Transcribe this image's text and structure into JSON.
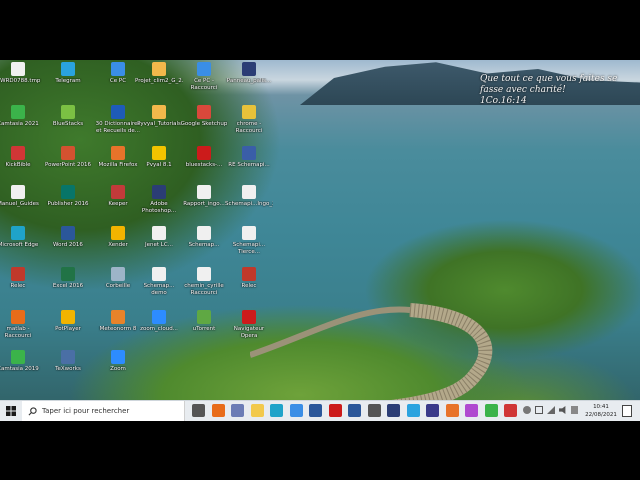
{
  "quote": {
    "line1": "Que tout ce que vous faites se",
    "line2": "fasse avec charité!",
    "line3": "1Co.16:14"
  },
  "icons": [
    {
      "label": "~WRD0788.tmp",
      "icon": "file-icon",
      "color": "#f0f0f0"
    },
    {
      "label": "Telegram",
      "icon": "telegram-icon",
      "color": "#2aa3df"
    },
    {
      "label": "Ce PC",
      "icon": "computer-icon",
      "color": "#3a8ee6"
    },
    {
      "label": "Projet_clim2_G_2...",
      "icon": "file-icon",
      "color": "#f2b84b"
    },
    {
      "label": "Ce PC - Raccourci",
      "icon": "computer-icon",
      "color": "#3a8ee6"
    },
    {
      "label": "Panneau_palis...",
      "icon": "photoshop-icon",
      "color": "#2b3d75"
    },
    {
      "label": "Camtasia 2021",
      "icon": "camtasia-icon",
      "color": "#3bb34a"
    },
    {
      "label": "BlueStacks",
      "icon": "bluestacks-icon",
      "color": "#7bc043"
    },
    {
      "label": "30 Dictionnaires et Recueils de...",
      "icon": "book-icon",
      "color": "#1e5bb8"
    },
    {
      "label": "Pyvyal_Tutorials",
      "icon": "file-icon",
      "color": "#f2b84b"
    },
    {
      "label": "Google Sketchup",
      "icon": "sketchup-icon",
      "color": "#d9483b"
    },
    {
      "label": "chrome - Raccourci",
      "icon": "chrome-icon",
      "color": "#e8c23a"
    },
    {
      "label": "KickBible",
      "icon": "bible-icon",
      "color": "#d03636"
    },
    {
      "label": "PowerPoint 2016",
      "icon": "powerpoint-icon",
      "color": "#d35230"
    },
    {
      "label": "Mozilla Firefox",
      "icon": "firefox-icon",
      "color": "#e8732a"
    },
    {
      "label": "Pvyal 8.1",
      "icon": "file-icon",
      "color": "#f2c400"
    },
    {
      "label": "bluestacks-...",
      "icon": "opera-icon",
      "color": "#cc1b1b"
    },
    {
      "label": "RE Schemapi...",
      "icon": "file-icon",
      "color": "#3a5ea8"
    },
    {
      "label": "Manuel_Guides",
      "icon": "file-icon",
      "color": "#f0f0f0"
    },
    {
      "label": "Publisher 2016",
      "icon": "publisher-icon",
      "color": "#077568"
    },
    {
      "label": "Keeper",
      "icon": "file-icon",
      "color": "#c23a3a"
    },
    {
      "label": "Adobe Photoshop...",
      "icon": "photoshop-icon",
      "color": "#2b3d75"
    },
    {
      "label": "Rapport_ingo...",
      "icon": "file-icon",
      "color": "#f0f0f0"
    },
    {
      "label": "Schemapi...Ingo_2(1)",
      "icon": "file-icon",
      "color": "#f0f0f0"
    },
    {
      "label": "Microsoft Edge",
      "icon": "edge-icon",
      "color": "#1fa3c9"
    },
    {
      "label": "Word 2016",
      "icon": "word-icon",
      "color": "#2b579a"
    },
    {
      "label": "Xender",
      "icon": "xender-icon",
      "color": "#f2b400"
    },
    {
      "label": "Jenet LC...",
      "icon": "file-icon",
      "color": "#f0f0f0"
    },
    {
      "label": "Schemap...",
      "icon": "file-icon",
      "color": "#f0f0f0"
    },
    {
      "label": "Schemapi... Tierce...",
      "icon": "file-icon",
      "color": "#f0f0f0"
    },
    {
      "label": "Relec",
      "icon": "relec-icon",
      "color": "#c0392b"
    },
    {
      "label": "Excel 2016",
      "icon": "excel-icon",
      "color": "#217346"
    },
    {
      "label": "Corbeille",
      "icon": "recycle-bin-icon",
      "color": "#9db4c8"
    },
    {
      "label": "Schemap... demo",
      "icon": "file-icon",
      "color": "#f0f0f0"
    },
    {
      "label": "chemin_cyrille Raccourci",
      "icon": "file-icon",
      "color": "#f0f0f0"
    },
    {
      "label": "Relec",
      "icon": "relec-icon",
      "color": "#c0392b"
    },
    {
      "label": "matlab - Raccourci",
      "icon": "matlab-icon",
      "color": "#e86c1a"
    },
    {
      "label": "PotPlayer",
      "icon": "potplayer-icon",
      "color": "#f2b400"
    },
    {
      "label": "Meteonorm 8",
      "icon": "meteonorm-icon",
      "color": "#e8832a"
    },
    {
      "label": "zoom_cloud...",
      "icon": "zoom-icon",
      "color": "#2d8cff"
    },
    {
      "label": "uTorrent",
      "icon": "utorrent-icon",
      "color": "#5fa843"
    },
    {
      "label": "Navigateur Opera",
      "icon": "opera-icon",
      "color": "#cc1b1b"
    },
    {
      "label": "Camtasia 2019",
      "icon": "camtasia-icon",
      "color": "#3bb34a"
    },
    {
      "label": "TeXworks",
      "icon": "texworks-icon",
      "color": "#4a6fa5"
    },
    {
      "label": "Zoom",
      "icon": "zoom-icon",
      "color": "#2d8cff"
    }
  ],
  "taskbar": {
    "search_placeholder": "Taper ici pour rechercher",
    "time": "10:41",
    "date": "22/08/2021",
    "apps": [
      {
        "icon": "task-view-icon",
        "color": "#555555"
      },
      {
        "icon": "matlab-icon",
        "color": "#e86c1a"
      },
      {
        "icon": "app-icon",
        "color": "#6b7cb5"
      },
      {
        "icon": "explorer-icon",
        "color": "#f2c94c"
      },
      {
        "icon": "edge-icon",
        "color": "#1fa3c9"
      },
      {
        "icon": "store-icon",
        "color": "#3a8ee6"
      },
      {
        "icon": "mail-icon",
        "color": "#2b579a"
      },
      {
        "icon": "opera-icon",
        "color": "#cc1b1b"
      },
      {
        "icon": "word-icon",
        "color": "#2b579a"
      },
      {
        "icon": "monitor-icon",
        "color": "#555555"
      },
      {
        "icon": "photoshop-icon",
        "color": "#2b3d75"
      },
      {
        "icon": "skype-icon",
        "color": "#2aa3df"
      },
      {
        "icon": "bible-icon",
        "color": "#3a3a8a"
      },
      {
        "icon": "firefox-icon",
        "color": "#e8732a"
      },
      {
        "icon": "paint-icon",
        "color": "#b04ad0"
      },
      {
        "icon": "camtasia-icon",
        "color": "#3bb34a"
      },
      {
        "icon": "app-icon",
        "color": "#d03636"
      }
    ]
  }
}
